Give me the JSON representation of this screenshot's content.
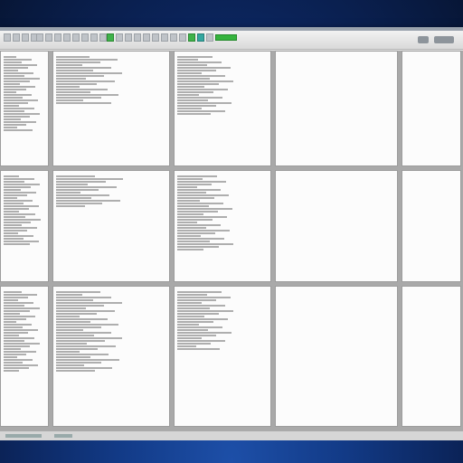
{
  "window": {
    "title": "",
    "toolbar_icons": [
      "new-icon",
      "open-icon",
      "save-icon",
      "print-icon",
      "cut-icon",
      "copy-icon",
      "paste-icon",
      "undo-icon",
      "redo-icon",
      "run-icon",
      "stop-icon",
      "debug-icon",
      "zoom-icon",
      "settings-icon",
      "help-icon"
    ]
  },
  "panes": [
    {
      "name": "pane-r1c1"
    },
    {
      "name": "pane-r1c2"
    },
    {
      "name": "pane-r1c3"
    },
    {
      "name": "pane-r1c4"
    },
    {
      "name": "pane-r1c5"
    },
    {
      "name": "pane-r2c1"
    },
    {
      "name": "pane-r2c2"
    },
    {
      "name": "pane-r2c3"
    },
    {
      "name": "pane-r2c4"
    },
    {
      "name": "pane-r2c5"
    },
    {
      "name": "pane-r3c1"
    },
    {
      "name": "pane-r3c2"
    },
    {
      "name": "pane-r3c3"
    },
    {
      "name": "pane-r3c4"
    },
    {
      "name": "pane-r3c5"
    }
  ],
  "status_bar": {
    "text": ""
  }
}
